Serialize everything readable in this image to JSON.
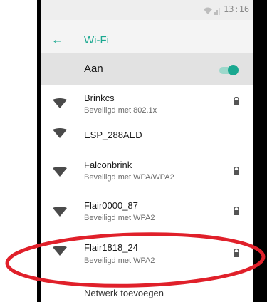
{
  "status_bar": {
    "time": "13:16",
    "icons": [
      "wifi-icon",
      "signal-icon"
    ]
  },
  "app_bar": {
    "back_icon": "arrow-left-icon",
    "title": "Wi-Fi"
  },
  "master_switch": {
    "label": "Aan",
    "state": "on"
  },
  "networks": [
    {
      "name": "Brinkcs",
      "security": "Beveiligd met 802.1x",
      "locked": true
    },
    {
      "name": "ESP_288AED",
      "security": "",
      "locked": false
    },
    {
      "name": "Falconbrink",
      "security": "Beveiligd met WPA/WPA2",
      "locked": true
    },
    {
      "name": "Flair0000_87",
      "security": "Beveiligd met WPA2",
      "locked": true
    },
    {
      "name": "Flair1818_24",
      "security": "Beveiligd met WPA2",
      "locked": true
    }
  ],
  "add_network_label": "Netwerk toevoegen",
  "colors": {
    "accent": "#1aa890",
    "highlight": "#e0202a"
  }
}
